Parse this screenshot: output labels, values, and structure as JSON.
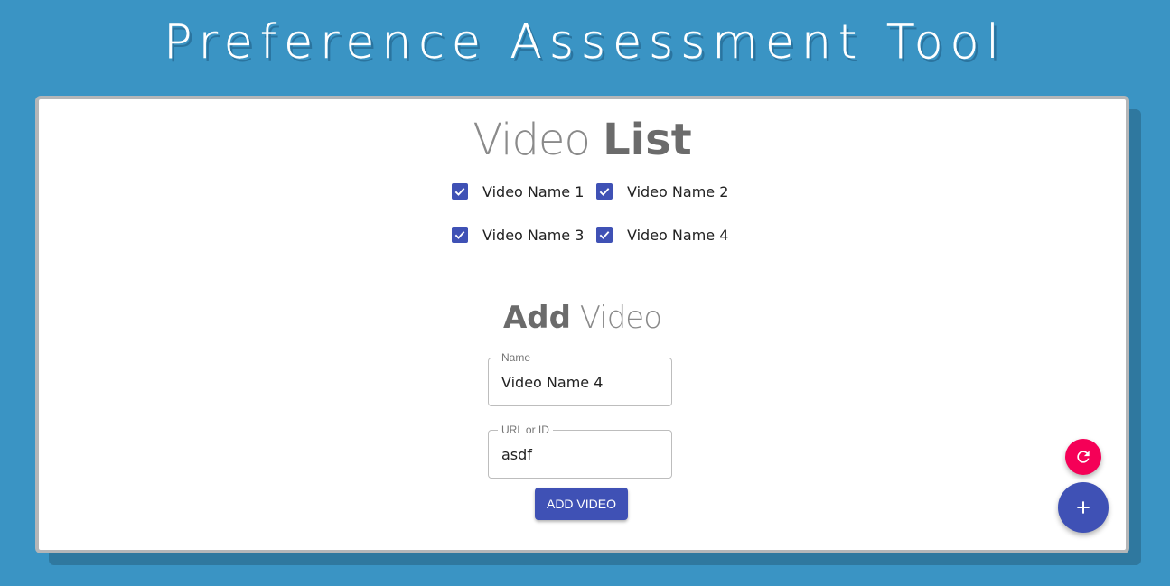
{
  "app": {
    "title": "Preference Assessment Tool"
  },
  "video_list": {
    "title_light": "Video ",
    "title_bold": "List",
    "items": [
      {
        "label": "Video Name 1",
        "checked": true
      },
      {
        "label": "Video Name 2",
        "checked": true
      },
      {
        "label": "Video Name 3",
        "checked": true
      },
      {
        "label": "Video Name 4",
        "checked": true
      }
    ]
  },
  "add_video": {
    "title_bold": "Add",
    "title_light": " Video",
    "name_field": {
      "label": "Name",
      "value": "Video Name 4"
    },
    "url_field": {
      "label": "URL or ID",
      "value": "asdf"
    },
    "button_label": "ADD VIDEO"
  },
  "fabs": {
    "refresh_icon": "refresh-icon",
    "add_icon": "plus-icon"
  },
  "colors": {
    "background": "#3a94c4",
    "primary": "#3f51b5",
    "secondary": "#f50057"
  }
}
